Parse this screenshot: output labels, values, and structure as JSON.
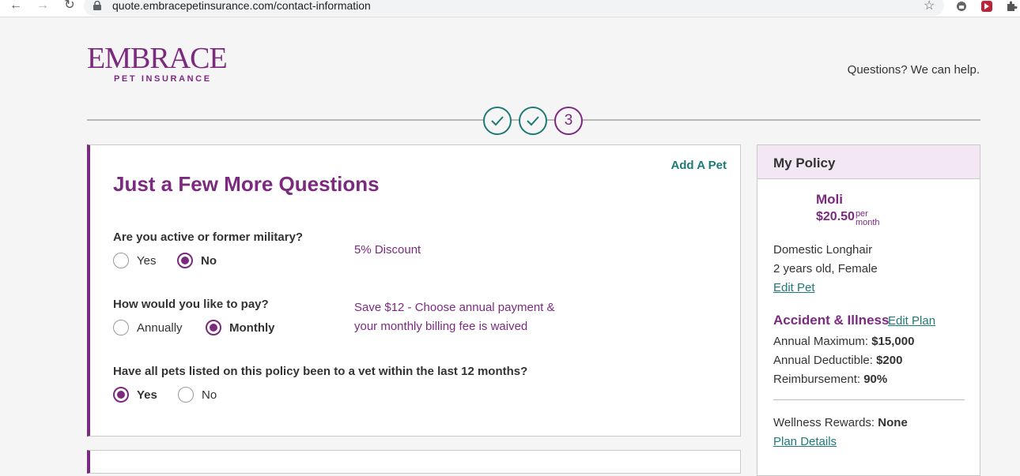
{
  "browser": {
    "url": "quote.embracepetinsurance.com/contact-information"
  },
  "header": {
    "logo_main": "EMBRACE",
    "logo_sub": "PET INSURANCE",
    "help_text": "Questions? We can help."
  },
  "progress": {
    "current_step_label": "3"
  },
  "form": {
    "add_pet": "Add A Pet",
    "title": "Just a Few More Questions",
    "questions": [
      {
        "label": "Are you active or former military?",
        "options": [
          "Yes",
          "No"
        ],
        "selected": "No",
        "note": "5% Discount"
      },
      {
        "label": "How would you like to pay?",
        "options": [
          "Annually",
          "Monthly"
        ],
        "selected": "Monthly",
        "note": "Save $12 - Choose annual payment & your monthly billing fee is waived"
      },
      {
        "label": "Have all pets listed on this policy been to a vet within the last 12 months?",
        "options": [
          "Yes",
          "No"
        ],
        "selected": "Yes"
      }
    ]
  },
  "policy": {
    "title": "My Policy",
    "pet": {
      "name": "Moli",
      "price": "$20.50",
      "per": "per",
      "month": "month",
      "breed": "Domestic Longhair",
      "details": "2 years old, Female",
      "edit_pet": "Edit Pet"
    },
    "plan": {
      "name": "Accident & Illness",
      "edit_plan": "Edit Plan",
      "annual_max_label": "Annual Maximum:",
      "annual_max_value": "$15,000",
      "deductible_label": "Annual Deductible:",
      "deductible_value": "$200",
      "reimbursement_label": "Reimbursement:",
      "reimbursement_value": "90%"
    },
    "wellness_label": "Wellness Rewards:",
    "wellness_value": "None",
    "plan_details": "Plan Details"
  },
  "colors": {
    "brand_purple": "#7b2a80",
    "teal": "#1e7a76",
    "policy_header_bg": "#f3e7f3"
  }
}
